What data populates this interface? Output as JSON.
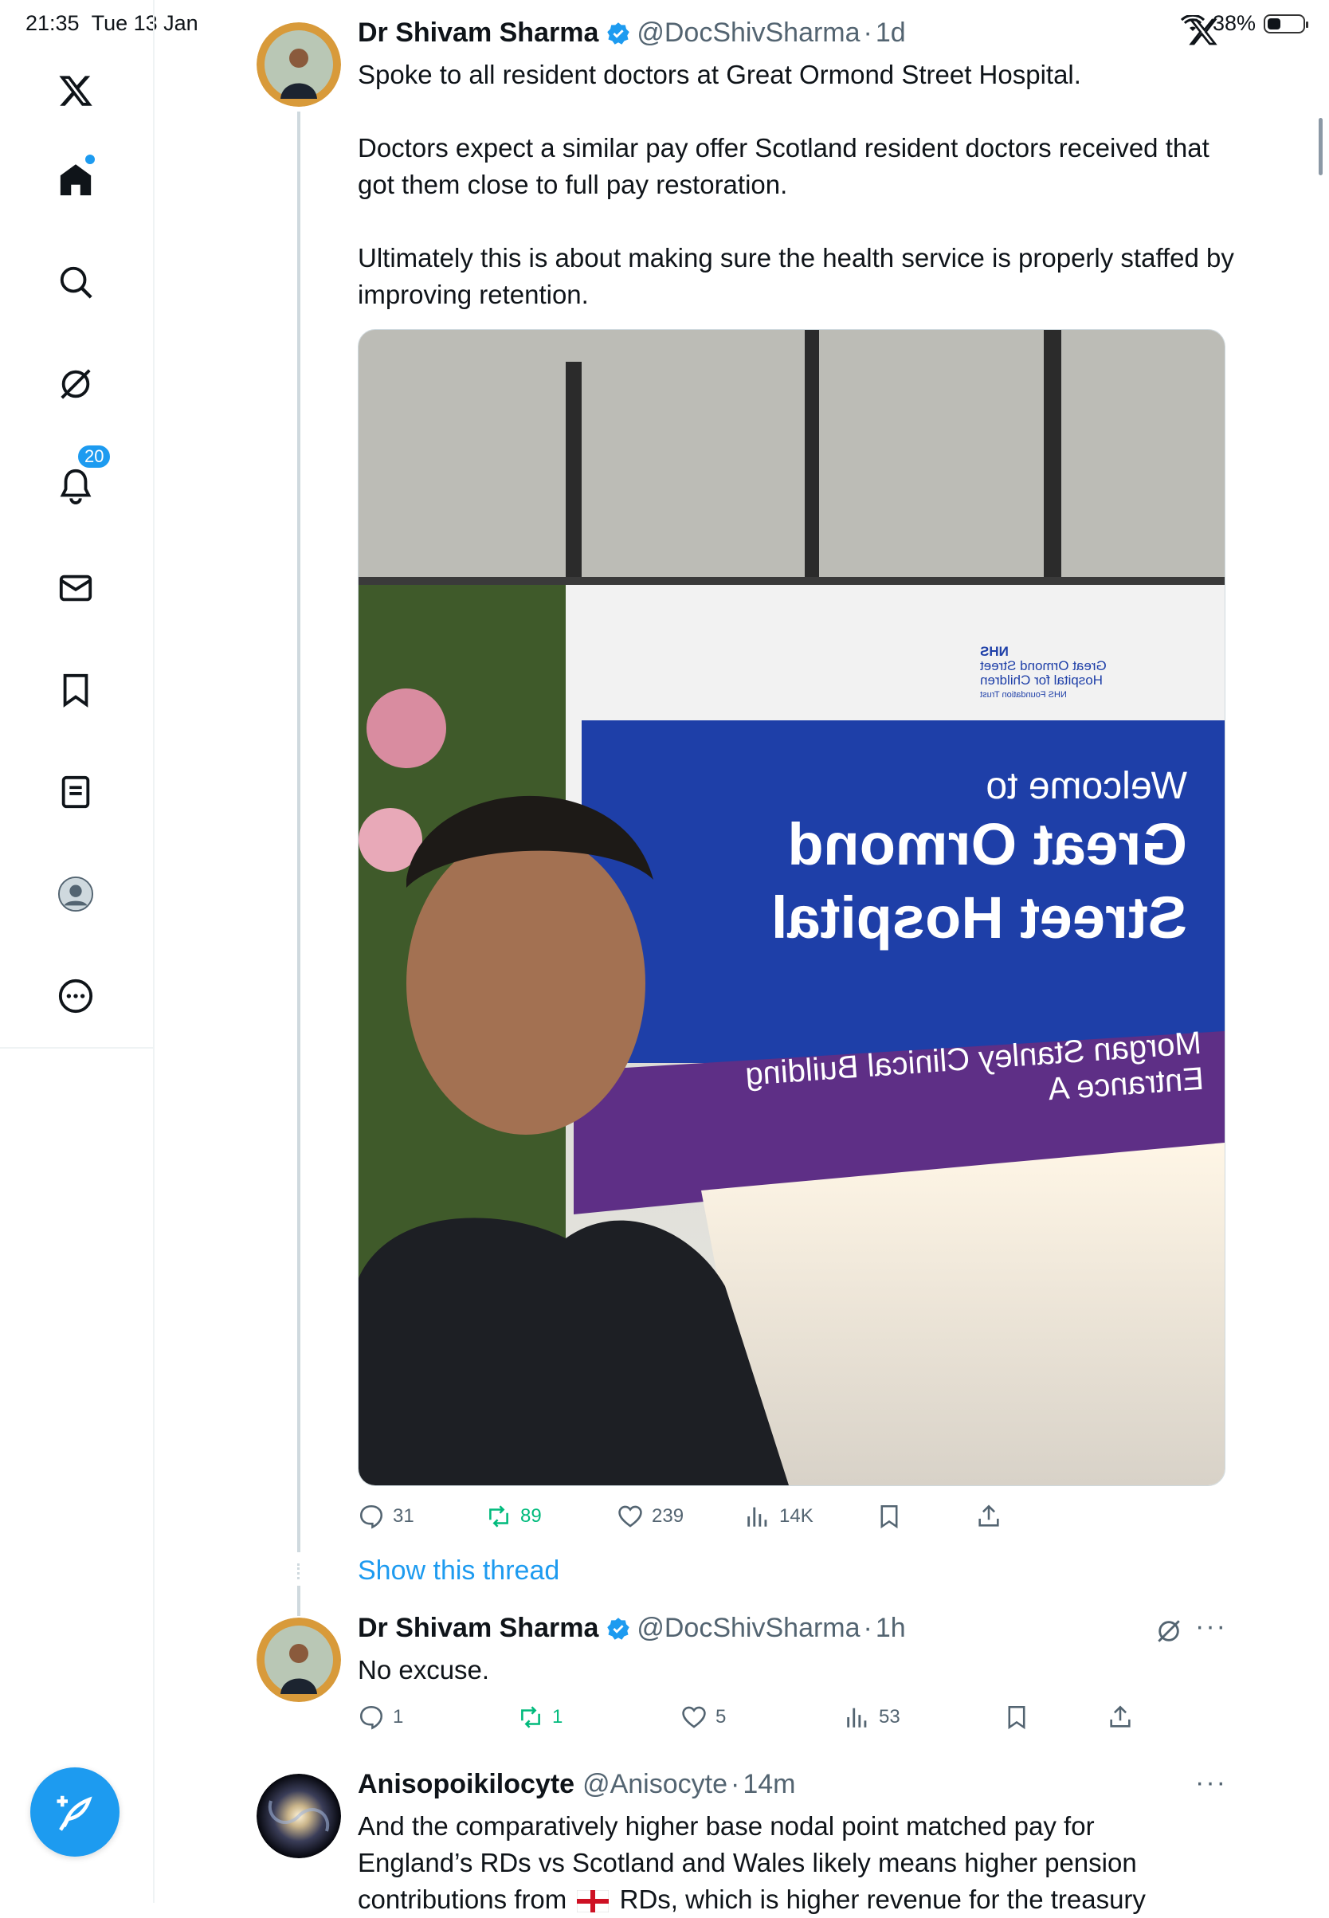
{
  "status": {
    "time": "21:35",
    "date": "Tue 13 Jan",
    "battery": "38%",
    "battery_level": 0.38
  },
  "sidebar": {
    "items": [
      {
        "name": "x-logo"
      },
      {
        "name": "home"
      },
      {
        "name": "search"
      },
      {
        "name": "grok"
      },
      {
        "name": "notifications",
        "badge": "20"
      },
      {
        "name": "messages"
      },
      {
        "name": "bookmarks"
      },
      {
        "name": "lists"
      },
      {
        "name": "profile"
      },
      {
        "name": "more"
      }
    ],
    "compose_icon": "compose-icon"
  },
  "tweets": [
    {
      "name": "Dr Shivam Sharma",
      "handle": "@DocShivSharma",
      "dot": "·",
      "time": "1d",
      "paragraphs": [
        "Spoke to all resident doctors at Great Ormond Street Hospital.",
        "Doctors expect a similar pay offer Scotland resident doctors received that got them close to full pay restoration.",
        "Ultimately this is about making sure the health service is properly staffed by improving retention."
      ],
      "media": {
        "sign_nhs": "NHS",
        "sign_org_1": "Great Ormond Street",
        "sign_org_2": "Hospital for Children",
        "sign_org_3": "NHS Foundation Trust",
        "sign_welcome": "Welcome to",
        "sign_title_1": "Great Ormond",
        "sign_title_2": "Street Hospital",
        "sign_purple_1": "Morgan Stanley Clinical Building",
        "sign_purple_2": "Entrance A"
      },
      "replies": "31",
      "reposts": "89",
      "likes": "239",
      "views": "14K"
    },
    {
      "show_thread": "Show this thread",
      "name": "Dr Shivam Sharma",
      "handle": "@DocShivSharma",
      "dot": "·",
      "time": "1h",
      "text": "No excuse.",
      "replies": "1",
      "reposts": "1",
      "likes": "5",
      "views": "53",
      "more": "···"
    },
    {
      "name": "Anisopoikilocyte",
      "handle": "@Anisocyte",
      "dot": "·",
      "time": "14m",
      "text_1": "And the comparatively higher base nodal point matched pay for",
      "text_2": "England’s RDs vs Scotland and Wales likely means higher pension",
      "text_3_a": "contributions from",
      "text_3_b": "RDs, which is higher revenue for the treasury",
      "more": "···"
    }
  ],
  "colors": {
    "accent": "#1d9bf0",
    "repost": "#00ba7c",
    "muted": "#536471",
    "divider": "#eff3f4"
  }
}
